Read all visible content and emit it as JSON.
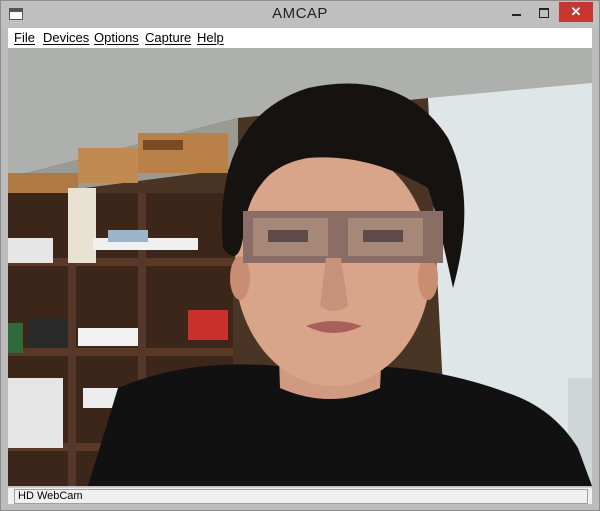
{
  "window": {
    "title": "AMCAP"
  },
  "menu": [
    {
      "label": "File"
    },
    {
      "label": "Devices"
    },
    {
      "label": "Options"
    },
    {
      "label": "Capture"
    },
    {
      "label": "Help"
    }
  ],
  "controls": {
    "close_glyph": "✕"
  },
  "preview": {
    "subject": "webcam-preview"
  },
  "status": {
    "text": "HD WebCam"
  }
}
